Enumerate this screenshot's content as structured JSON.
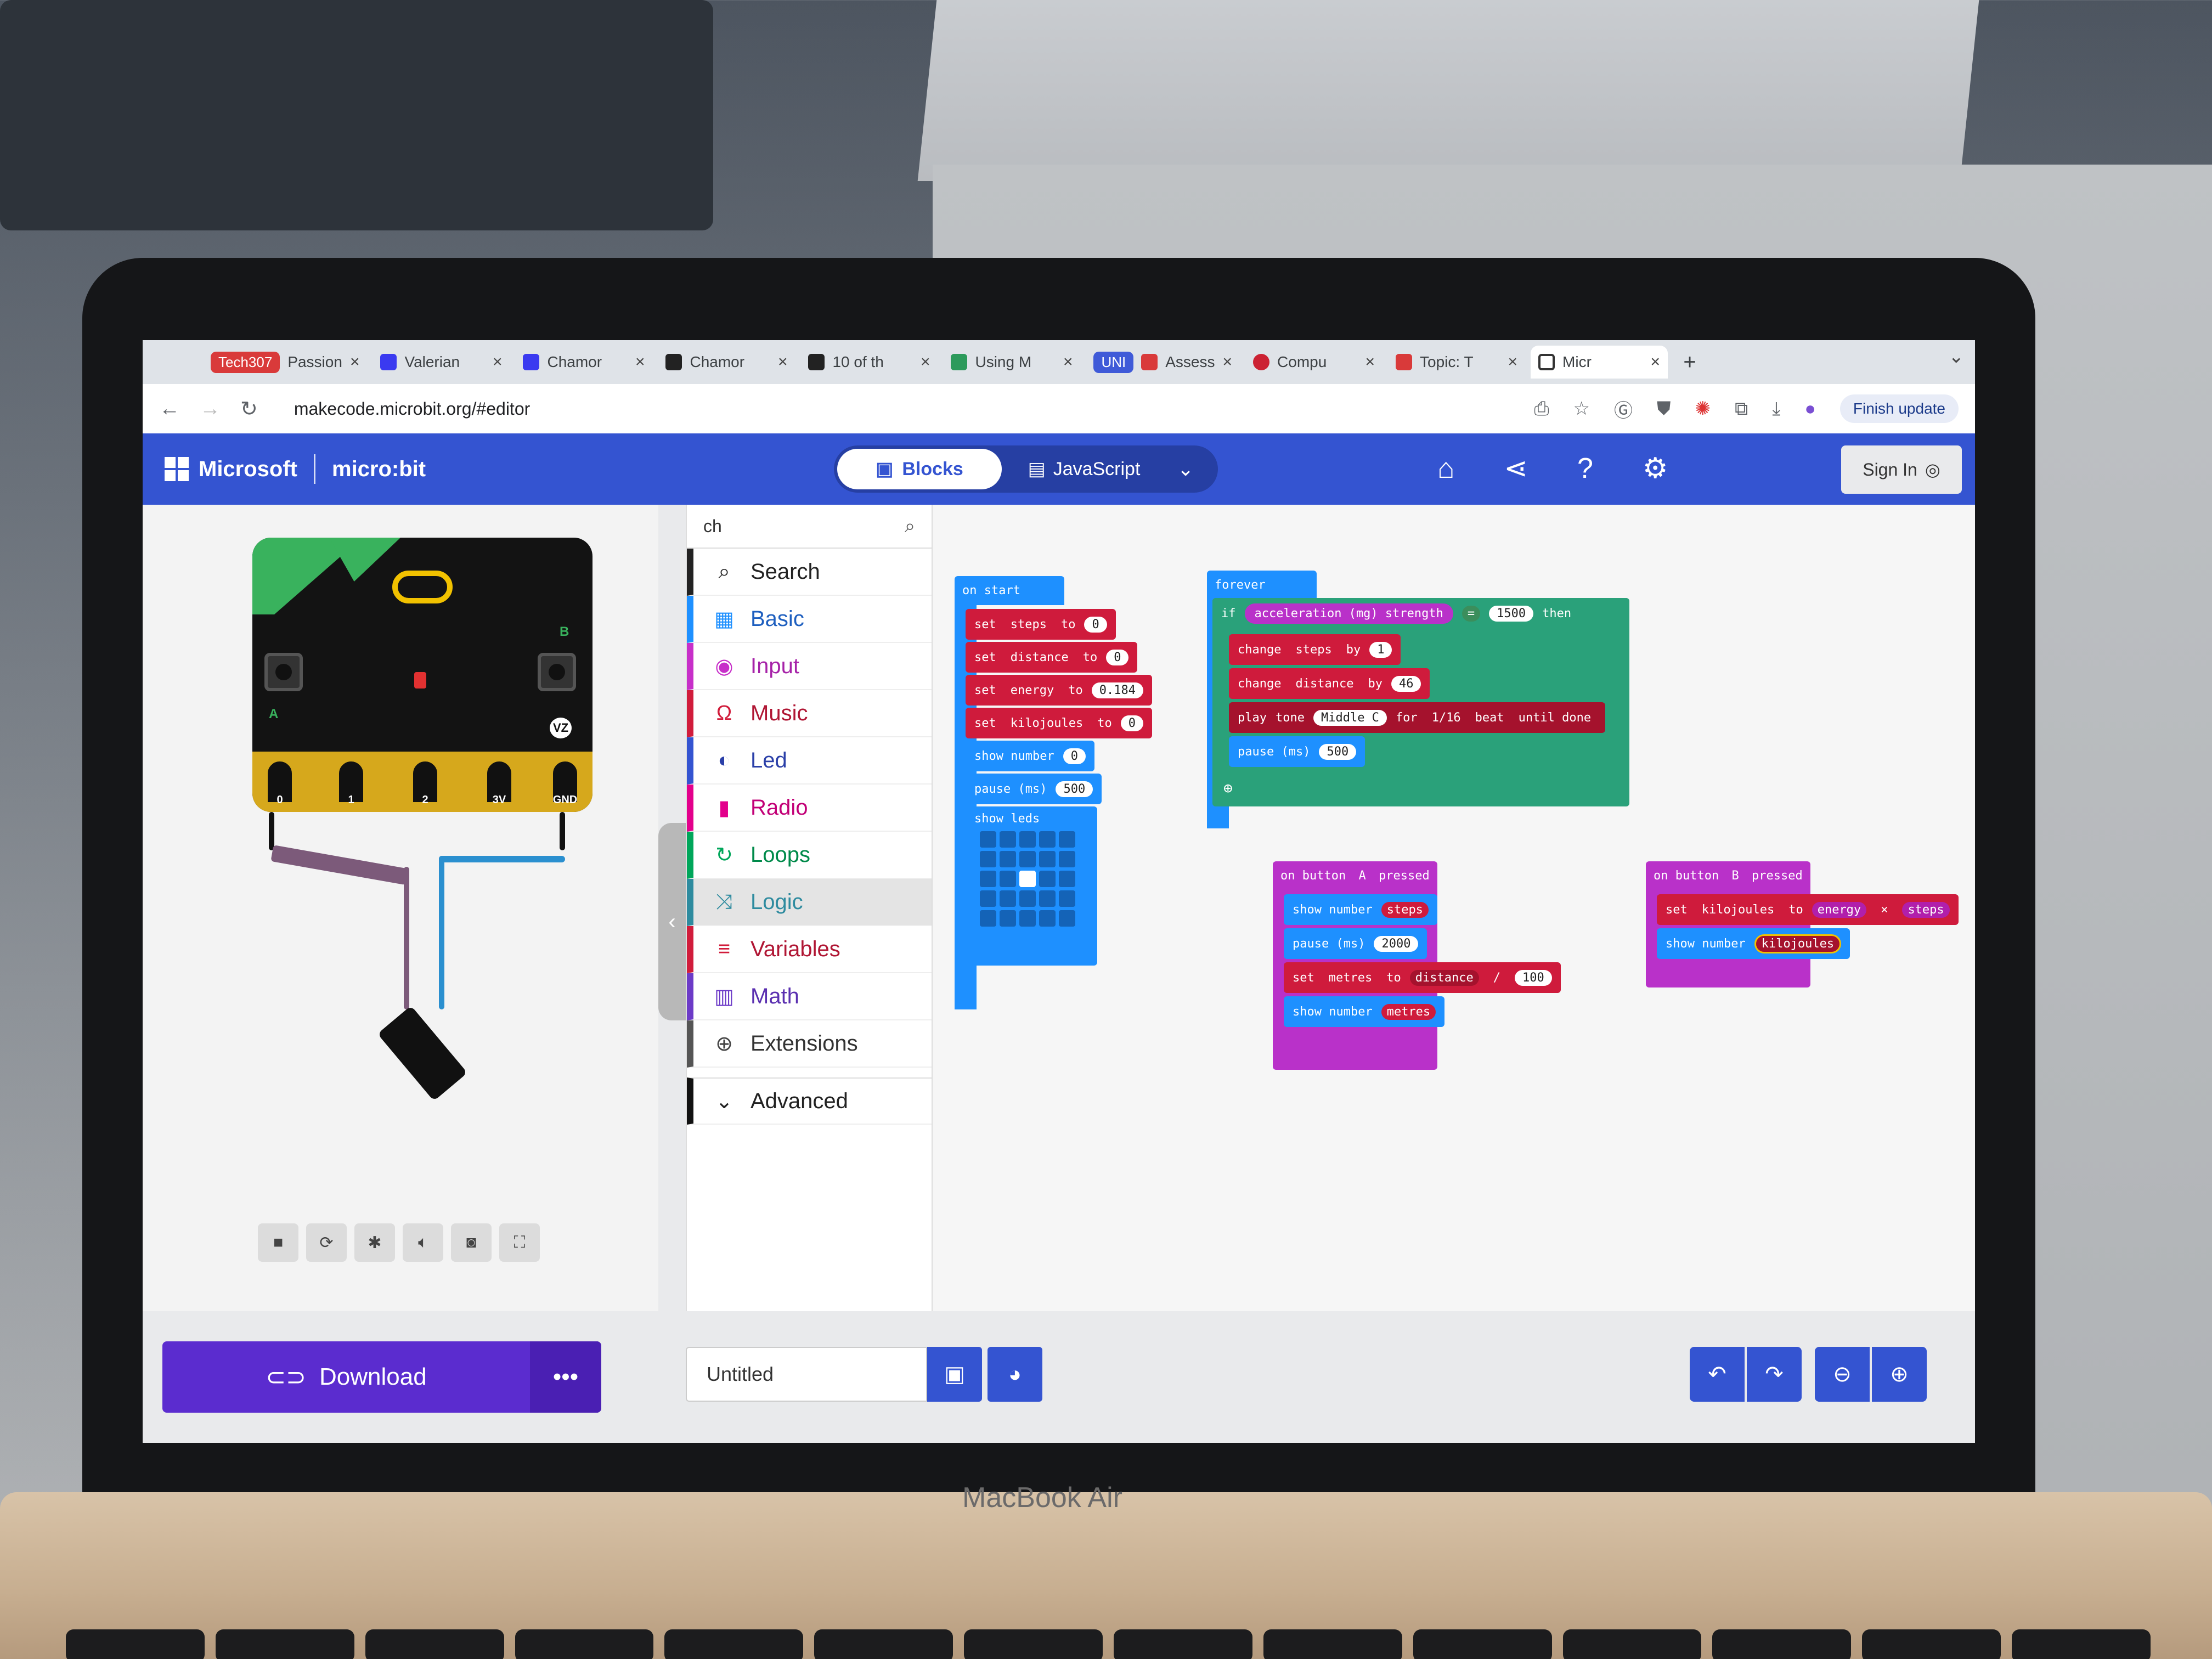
{
  "browser": {
    "tabs": [
      {
        "badge": "Tech307",
        "title": "Passion"
      },
      {
        "title": "Valerian"
      },
      {
        "title": "Chamor"
      },
      {
        "title": "Chamor"
      },
      {
        "title": "10 of th"
      },
      {
        "title": "Using M"
      },
      {
        "badge": "UNI",
        "title": "Assess"
      },
      {
        "title": "Compu"
      },
      {
        "title": "Topic: T"
      },
      {
        "title": "Micr",
        "active": true
      }
    ],
    "new_tab": "+",
    "url": "makecode.microbit.org/#editor",
    "finish_update": "Finish update"
  },
  "header": {
    "brand": "Microsoft",
    "product": "micro:bit",
    "mode_blocks": "Blocks",
    "mode_js": "JavaScript",
    "sign_in": "Sign In"
  },
  "simulator": {
    "pins": [
      "0",
      "1",
      "2",
      "3V",
      "GND"
    ],
    "button_a": "A",
    "button_b": "B",
    "badge": "VZ"
  },
  "toolbox": {
    "search_value": "ch",
    "categories": [
      {
        "label": "Search",
        "color": "#333333",
        "icon": "search-icon"
      },
      {
        "label": "Basic",
        "color": "#1e90ff",
        "icon": "grid-icon"
      },
      {
        "label": "Input",
        "color": "#c72fc9",
        "icon": "target-icon"
      },
      {
        "label": "Music",
        "color": "#d11c3b",
        "icon": "headphones-icon"
      },
      {
        "label": "Led",
        "color": "#3454d1",
        "icon": "toggle-icon"
      },
      {
        "label": "Radio",
        "color": "#e3008c",
        "icon": "signal-icon"
      },
      {
        "label": "Loops",
        "color": "#00a65a",
        "icon": "refresh-icon"
      },
      {
        "label": "Logic",
        "color": "#2e8b9f",
        "icon": "shuffle-icon"
      },
      {
        "label": "Variables",
        "color": "#d11c3b",
        "icon": "lines-icon"
      },
      {
        "label": "Math",
        "color": "#6c3ac7",
        "icon": "calculator-icon"
      },
      {
        "label": "Extensions",
        "color": "#555555",
        "icon": "plus-circle-icon"
      }
    ],
    "advanced": "Advanced"
  },
  "blocks": {
    "on_start": {
      "hat": "on start",
      "set_steps": {
        "kw": "set",
        "var": "steps",
        "to": "to",
        "val": "0"
      },
      "set_distance": {
        "kw": "set",
        "var": "distance",
        "to": "to",
        "val": "0"
      },
      "set_energy": {
        "kw": "set",
        "var": "energy",
        "to": "to",
        "val": "0.184"
      },
      "set_kj": {
        "kw": "set",
        "var": "kilojoules",
        "to": "to",
        "val": "0"
      },
      "show_number": {
        "kw": "show number",
        "val": "0"
      },
      "pause": {
        "kw": "pause (ms)",
        "val": "500"
      },
      "show_leds": "show leds"
    },
    "forever": {
      "hat": "forever",
      "if_kw": "if",
      "cond_sensor": "acceleration (mg)",
      "cond_dim": "strength",
      "cond_op": "=",
      "cond_val": "1500",
      "then_kw": "then",
      "change_steps": {
        "kw": "change",
        "var": "steps",
        "by": "by",
        "val": "1"
      },
      "change_distance": {
        "kw": "change",
        "var": "distance",
        "by": "by",
        "val": "46"
      },
      "play": {
        "kw": "play",
        "tone": "tone",
        "note": "Middle C",
        "for": "for",
        "beat": "1/16",
        "beat_kw": "beat",
        "until": "until done"
      },
      "pause": {
        "kw": "pause (ms)",
        "val": "500"
      }
    },
    "button_a": {
      "hat_kw": "on button",
      "btn": "A",
      "pressed": "pressed",
      "show_steps": {
        "kw": "show number",
        "var": "steps"
      },
      "pause": {
        "kw": "pause (ms)",
        "val": "2000"
      },
      "set_metres": {
        "kw": "set",
        "var": "metres",
        "to": "to",
        "lhs": "distance",
        "op": "/",
        "rhs": "100"
      },
      "show_metres": {
        "kw": "show number",
        "var": "metres"
      }
    },
    "button_b": {
      "hat_kw": "on button",
      "btn": "B",
      "pressed": "pressed",
      "set_kj": {
        "kw": "set",
        "var": "kilojoules",
        "to": "to",
        "lhs": "energy",
        "op": "×",
        "rhs": "steps"
      },
      "show_kj": {
        "kw": "show number",
        "var": "kilojoules"
      }
    }
  },
  "footer": {
    "download": "Download",
    "project_name": "Untitled"
  },
  "laptop": {
    "brand": "MacBook Air"
  }
}
